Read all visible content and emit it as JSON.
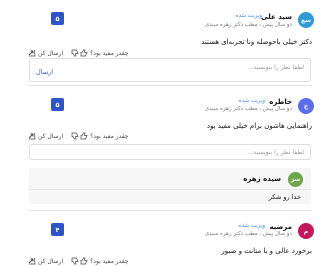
{
  "comments": [
    {
      "avatar_text": "سع",
      "avatar_color": "#2e9bd6",
      "name": "سید علی",
      "badge": "ویزیت شده",
      "meta": "دو سال پیش ، مطب دکتر زهره سیدی",
      "score": "۵",
      "text": "دکتر خیلی باحوصله ونا تجربه‌ای هستند",
      "reply_placeholder": "لطفا نظر را بنویسید...",
      "send_label": "ارسال"
    },
    {
      "avatar_text": "خ",
      "avatar_color": "#5b6ee8",
      "name": "خاطره",
      "badge": "ویزیت شده",
      "meta": "دو سال پیش ، مطب دکتر زهره سیدی",
      "score": "۵",
      "text": "راهنمایی هاشون برام خیلی مفید بود",
      "reply_placeholder": "لطفا نظر را بنویسید..."
    },
    {
      "avatar_text": "م",
      "avatar_color": "#c2185b",
      "name": "مرضیه",
      "badge": "ویزیت شده",
      "meta": "دو سال پیش ، مطب دکتر زهره سیدی",
      "score": "۴",
      "text": "برخورد عالی و با متانت و صبور"
    }
  ],
  "reply": {
    "avatar_text": "سز",
    "avatar_color": "#6ba54a",
    "name": "سیده زهره",
    "text": "خدا رو شکر"
  },
  "actions": {
    "helpful_label": "چقدر مفید بود؟",
    "send_label": "ارسال کن"
  }
}
